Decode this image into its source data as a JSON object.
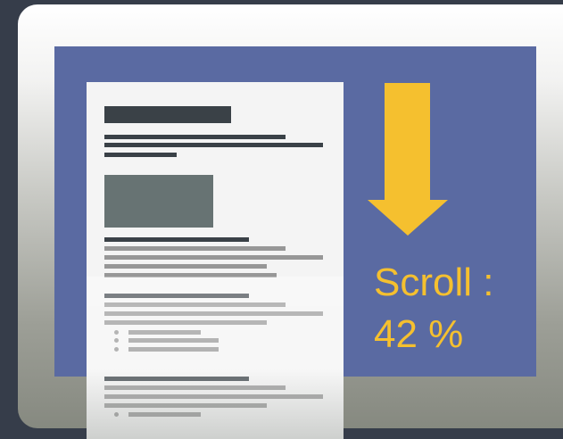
{
  "scroll_indicator": {
    "label": "Scroll :",
    "value_text": "42 %",
    "percent": 42
  },
  "colors": {
    "background": "#363d4a",
    "screen": "#5a6aa2",
    "accent": "#f5c02f",
    "document": "#f4f4f4"
  },
  "icons": {
    "arrow": "arrow-down-icon"
  }
}
